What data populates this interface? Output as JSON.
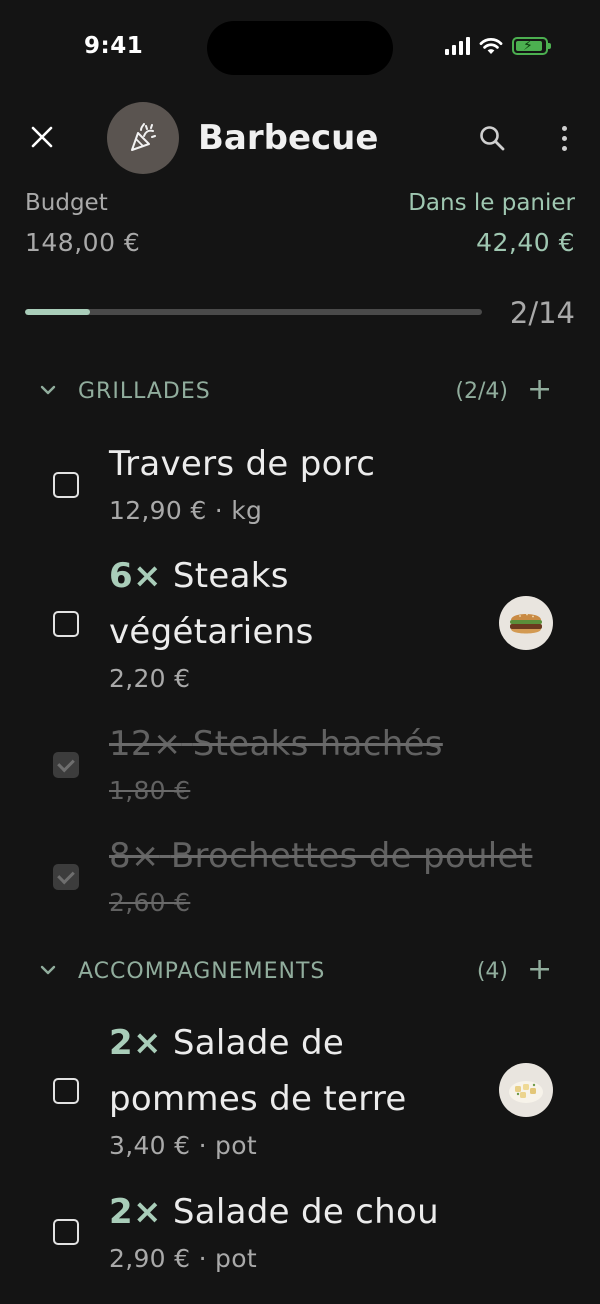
{
  "status": {
    "time": "9:41"
  },
  "header": {
    "title": "Barbecue",
    "avatar_icon": "party-popper-icon"
  },
  "summary": {
    "budget_label": "Budget",
    "budget_value": "148,00 €",
    "cart_label": "Dans le panier",
    "cart_value": "42,40 €",
    "progress": {
      "done": 2,
      "total": 14,
      "label": "2/14"
    }
  },
  "sections": [
    {
      "title": "GRILLADES",
      "count": "(2/4)",
      "items": [
        {
          "qty": "",
          "name": "Travers de porc",
          "price": "12,90 € · kg",
          "checked": false,
          "thumb": null
        },
        {
          "qty": "6×",
          "name": "Steaks végétariens",
          "price": "2,20 €",
          "checked": false,
          "thumb": "veggie-burger-thumbnail"
        },
        {
          "qty": "12×",
          "name": "Steaks hachés",
          "price": "1,80 €",
          "checked": true,
          "thumb": null
        },
        {
          "qty": "8×",
          "name": "Brochettes de poulet",
          "price": "2,60 €",
          "checked": true,
          "thumb": null
        }
      ]
    },
    {
      "title": "ACCOMPAGNEMENTS",
      "count": "(4)",
      "items": [
        {
          "qty": "2×",
          "name": "Salade de pommes de terre",
          "price": "3,40 € · pot",
          "checked": false,
          "thumb": "potato-salad-thumbnail"
        },
        {
          "qty": "2×",
          "name": "Salade de chou",
          "price": "2,90 € · pot",
          "checked": false,
          "thumb": null
        }
      ]
    }
  ],
  "colors": {
    "accent": "#a9cdb9",
    "muted_accent": "#91ad9d",
    "background": "#141414"
  }
}
